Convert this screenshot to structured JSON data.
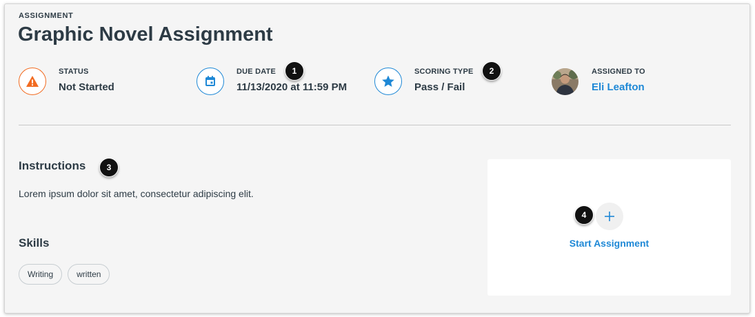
{
  "header": {
    "eyebrow": "ASSIGNMENT",
    "title": "Graphic Novel Assignment"
  },
  "meta": {
    "status": {
      "label": "STATUS",
      "value": "Not Started",
      "icon": "warning-icon",
      "color": "#f26b21"
    },
    "due_date": {
      "label": "DUE DATE",
      "value": "11/13/2020 at 11:59 PM",
      "icon": "calendar-icon",
      "color": "#1e88d6"
    },
    "scoring_type": {
      "label": "SCORING TYPE",
      "value": "Pass / Fail",
      "icon": "star-icon",
      "color": "#1e88d6"
    },
    "assigned_to": {
      "label": "ASSIGNED TO",
      "value": "Eli Leafton",
      "icon": "avatar"
    }
  },
  "instructions": {
    "heading": "Instructions",
    "text": "Lorem ipsum dolor sit amet, consectetur adipiscing elit."
  },
  "skills": {
    "heading": "Skills",
    "tags": [
      "Writing",
      "written"
    ]
  },
  "action_card": {
    "icon": "plus-icon",
    "label": "Start Assignment"
  },
  "callouts": [
    "1",
    "2",
    "3",
    "4"
  ],
  "colors": {
    "text": "#2d3b45",
    "accent": "#1e88d6",
    "warning": "#f26b21",
    "panel": "#f5f5f5"
  }
}
